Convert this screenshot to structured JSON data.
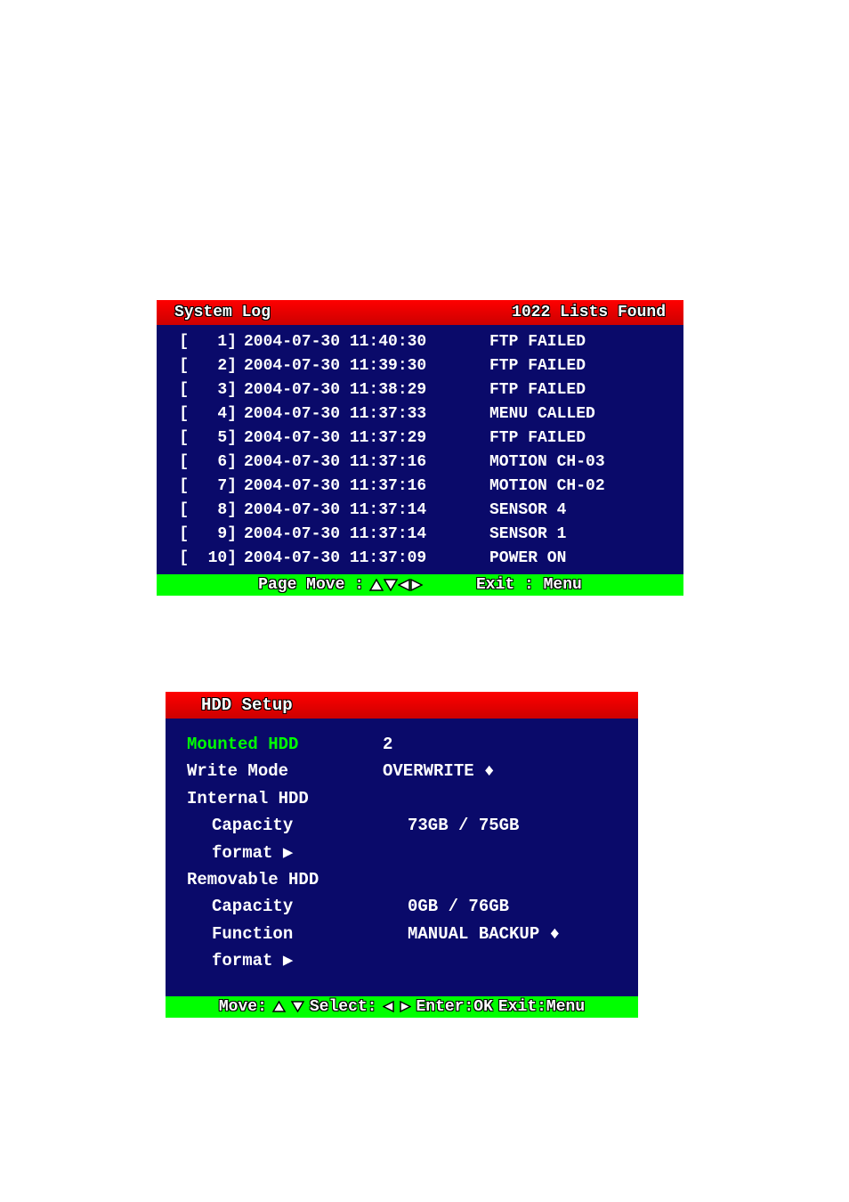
{
  "system_log": {
    "title": "System Log",
    "count_label": "1022 Lists Found",
    "entries": [
      {
        "idx": "[   1]",
        "dt": "2004-07-30 11:40:30",
        "ev": "FTP FAILED"
      },
      {
        "idx": "[   2]",
        "dt": "2004-07-30 11:39:30",
        "ev": "FTP FAILED"
      },
      {
        "idx": "[   3]",
        "dt": "2004-07-30 11:38:29",
        "ev": "FTP FAILED"
      },
      {
        "idx": "[   4]",
        "dt": "2004-07-30 11:37:33",
        "ev": "MENU CALLED"
      },
      {
        "idx": "[   5]",
        "dt": "2004-07-30 11:37:29",
        "ev": "FTP FAILED"
      },
      {
        "idx": "[   6]",
        "dt": "2004-07-30 11:37:16",
        "ev": "MOTION CH-03"
      },
      {
        "idx": "[   7]",
        "dt": "2004-07-30 11:37:16",
        "ev": "MOTION CH-02"
      },
      {
        "idx": "[   8]",
        "dt": "2004-07-30 11:37:14",
        "ev": "SENSOR 4"
      },
      {
        "idx": "[   9]",
        "dt": "2004-07-30 11:37:14",
        "ev": "SENSOR 1"
      },
      {
        "idx": "[  10]",
        "dt": "2004-07-30 11:37:09",
        "ev": "POWER ON"
      }
    ],
    "footer": {
      "page_move": "Page Move :",
      "exit": "Exit : Menu"
    }
  },
  "hdd_setup": {
    "title": "HDD Setup",
    "rows": {
      "mounted_label": "Mounted HDD",
      "mounted_value": "2",
      "write_mode_label": "Write Mode",
      "write_mode_value": "OVERWRITE",
      "internal_label": "Internal HDD",
      "internal_cap_label": "Capacity",
      "internal_cap_value": "73GB / 75GB",
      "internal_format_label": "format",
      "removable_label": "Removable HDD",
      "removable_cap_label": "Capacity",
      "removable_cap_value": "0GB / 76GB",
      "function_label": "Function",
      "function_value": "MANUAL BACKUP",
      "removable_format_label": "format"
    },
    "footer": {
      "move": "Move:",
      "select": "Select:",
      "enter": "Enter:OK",
      "exit": "Exit:Menu"
    }
  }
}
